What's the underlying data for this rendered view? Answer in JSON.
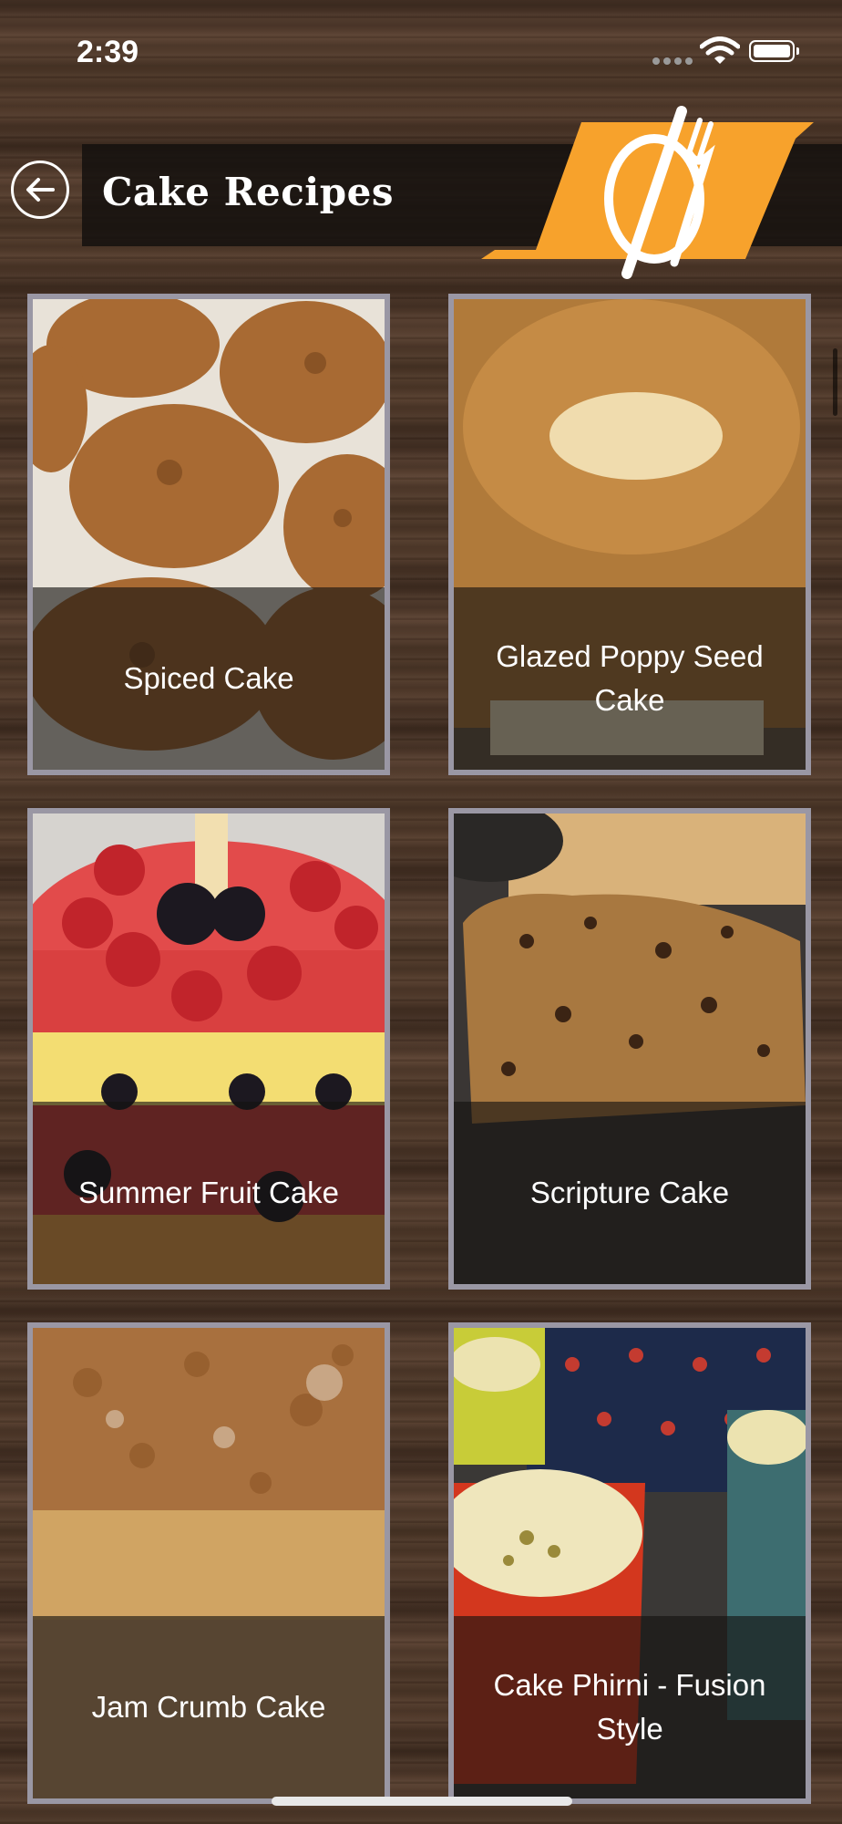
{
  "status": {
    "time": "2:39"
  },
  "header": {
    "title": "Cake Recipes"
  },
  "accent_color": "#f7a22c",
  "recipes": [
    {
      "label": "Spiced Cake"
    },
    {
      "label": "Glazed Poppy Seed Cake"
    },
    {
      "label": "Summer Fruit Cake"
    },
    {
      "label": "Scripture Cake"
    },
    {
      "label": "Jam Crumb Cake"
    },
    {
      "label": "Cake Phirni - Fusion Style"
    }
  ]
}
